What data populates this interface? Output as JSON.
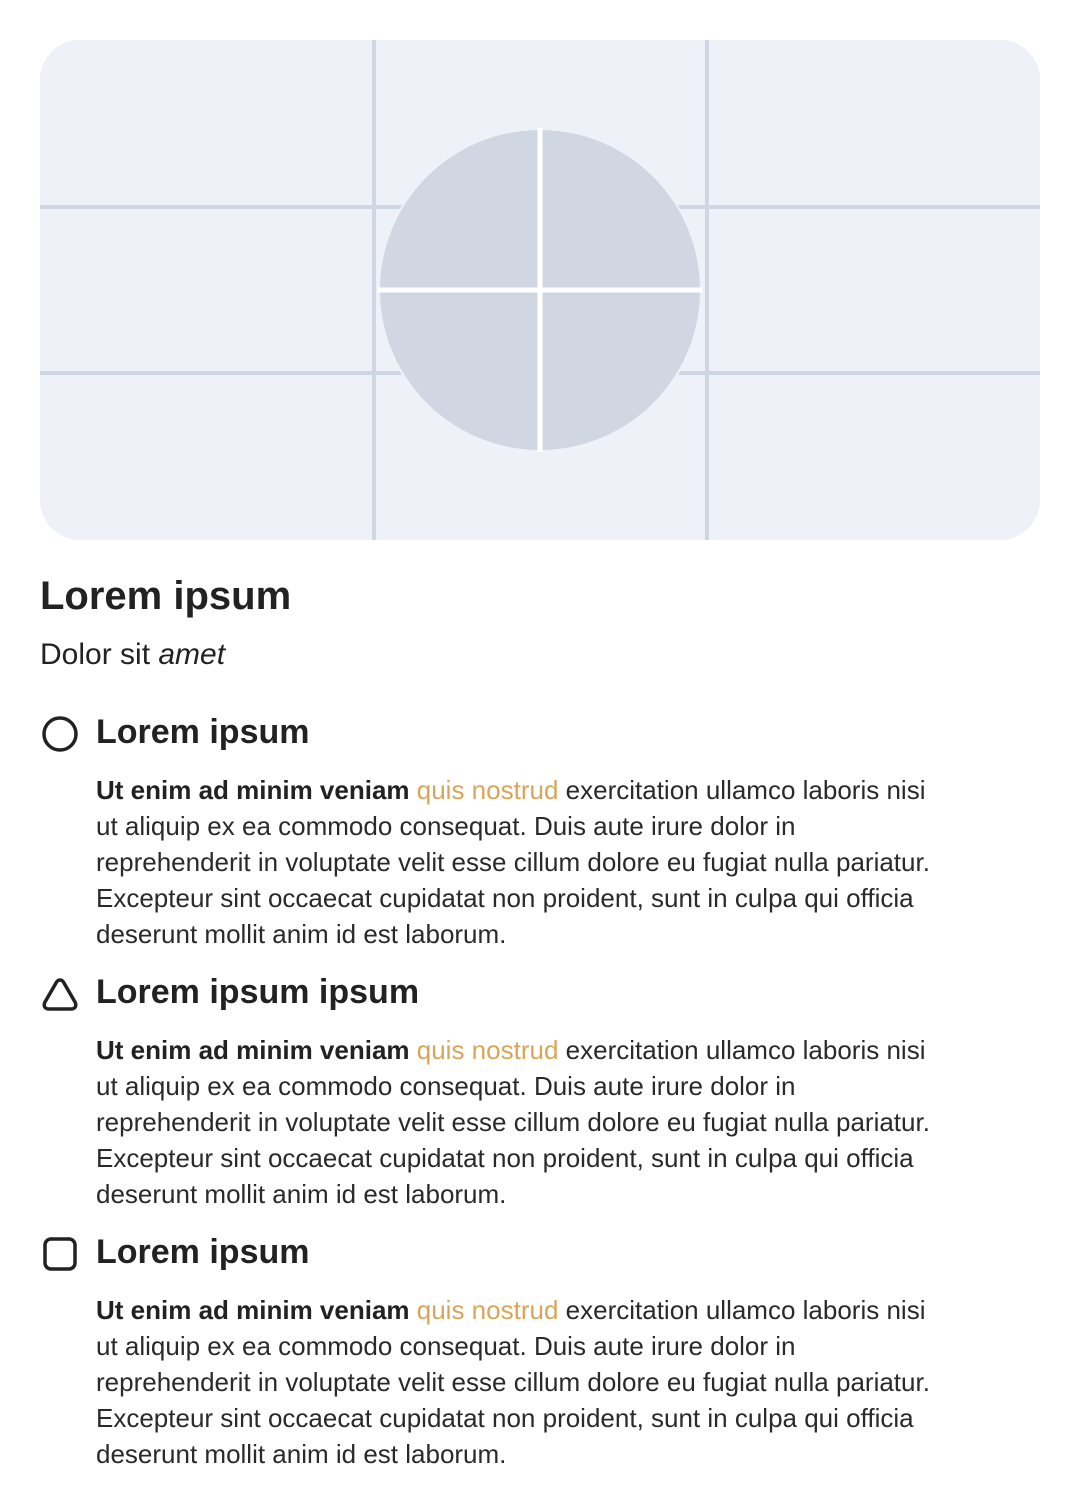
{
  "hero": {
    "image_alt": "placeholder image",
    "colors": {
      "background": "#eef1f8",
      "lines": "#cfd6e3",
      "shape": "#d0d7e3"
    }
  },
  "header": {
    "title": "Lorem ipsum",
    "subtitle_plain": "Dolor sit",
    "subtitle_italic": "amet"
  },
  "accent_color": "#d9a558",
  "sections": [
    {
      "icon": "circle-icon",
      "title": "Lorem ipsum",
      "lead_bold": "Ut enim ad minim veniam",
      "lead_accent": "quis nostrud",
      "body": "exercitation ullamco laboris nisi ut aliquip ex ea commodo consequat. Duis aute irure dolor in reprehenderit in voluptate velit esse cillum dolore eu fugiat nulla pariatur. Excepteur sint occaecat cupidatat non proident, sunt in culpa qui officia deserunt mollit anim id est laborum."
    },
    {
      "icon": "triangle-icon",
      "title": "Lorem ipsum ipsum",
      "lead_bold": "Ut enim ad minim veniam",
      "lead_accent": "quis nostrud",
      "body": "exercitation ullamco laboris nisi ut aliquip ex ea commodo consequat. Duis aute irure dolor in reprehenderit in voluptate velit esse cillum dolore eu fugiat nulla pariatur. Excepteur sint occaecat cupidatat non proident, sunt in culpa qui officia deserunt mollit anim id est laborum."
    },
    {
      "icon": "square-icon",
      "title": "Lorem ipsum",
      "lead_bold": "Ut enim ad minim veniam",
      "lead_accent": "quis nostrud",
      "body": "exercitation ullamco laboris nisi ut aliquip ex ea commodo consequat. Duis aute irure dolor in reprehenderit in voluptate velit esse cillum dolore eu fugiat nulla pariatur. Excepteur sint occaecat cupidatat non proident, sunt in culpa qui officia deserunt mollit anim id est laborum."
    }
  ]
}
